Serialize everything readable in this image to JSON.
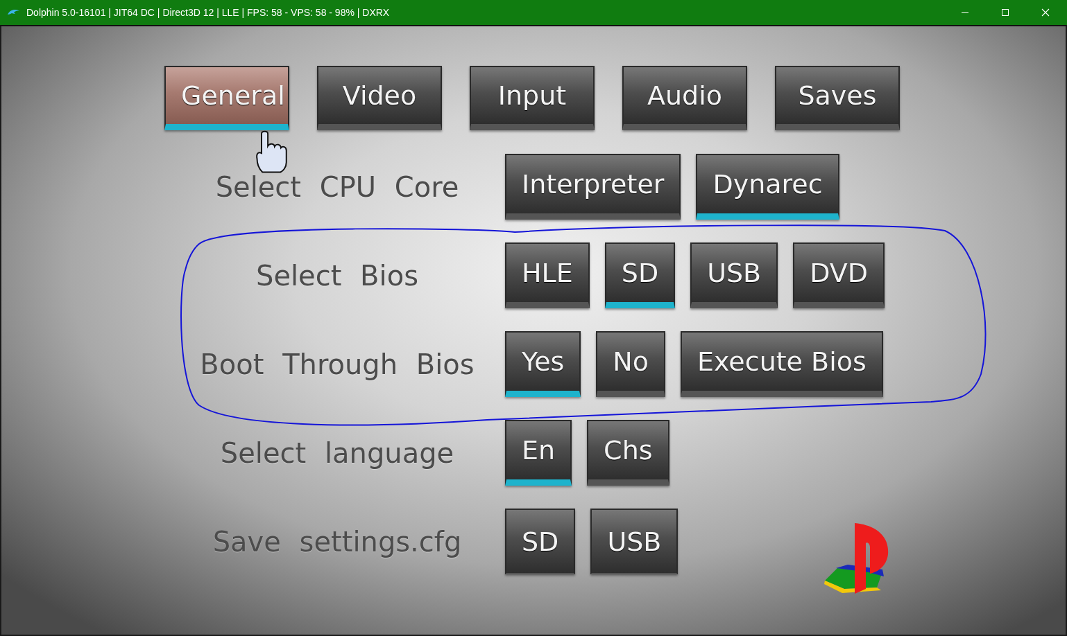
{
  "window": {
    "title": "Dolphin 5.0-16101 | JIT64 DC | Direct3D 12 | LLE | FPS: 58 - VPS: 58 - 98% | DXRX"
  },
  "tabs": [
    {
      "label": "General",
      "selected": true,
      "hovered": true
    },
    {
      "label": "Video",
      "selected": false,
      "hovered": false
    },
    {
      "label": "Input",
      "selected": false,
      "hovered": false
    },
    {
      "label": "Audio",
      "selected": false,
      "hovered": false
    },
    {
      "label": "Saves",
      "selected": false,
      "hovered": false
    }
  ],
  "settings": [
    {
      "label": "Select CPU Core",
      "options": [
        {
          "label": "Interpreter",
          "kind": "option",
          "selected": false
        },
        {
          "label": "Dynarec",
          "kind": "option",
          "selected": true
        }
      ]
    },
    {
      "label": "Select Bios",
      "options": [
        {
          "label": "HLE",
          "kind": "option",
          "selected": false
        },
        {
          "label": "SD",
          "kind": "option",
          "selected": true
        },
        {
          "label": "USB",
          "kind": "option",
          "selected": false
        },
        {
          "label": "DVD",
          "kind": "option",
          "selected": false
        }
      ]
    },
    {
      "label": "Boot Through Bios",
      "options": [
        {
          "label": "Yes",
          "kind": "option",
          "selected": true
        },
        {
          "label": "No",
          "kind": "option",
          "selected": false
        },
        {
          "label": "Execute Bios",
          "kind": "option",
          "selected": false
        }
      ]
    },
    {
      "label": "Select language",
      "options": [
        {
          "label": "En",
          "kind": "option",
          "selected": true
        },
        {
          "label": "Chs",
          "kind": "option",
          "selected": false
        }
      ]
    },
    {
      "label": "Save settings.cfg",
      "options": [
        {
          "label": "SD",
          "kind": "action"
        },
        {
          "label": "USB",
          "kind": "action"
        }
      ]
    }
  ]
}
